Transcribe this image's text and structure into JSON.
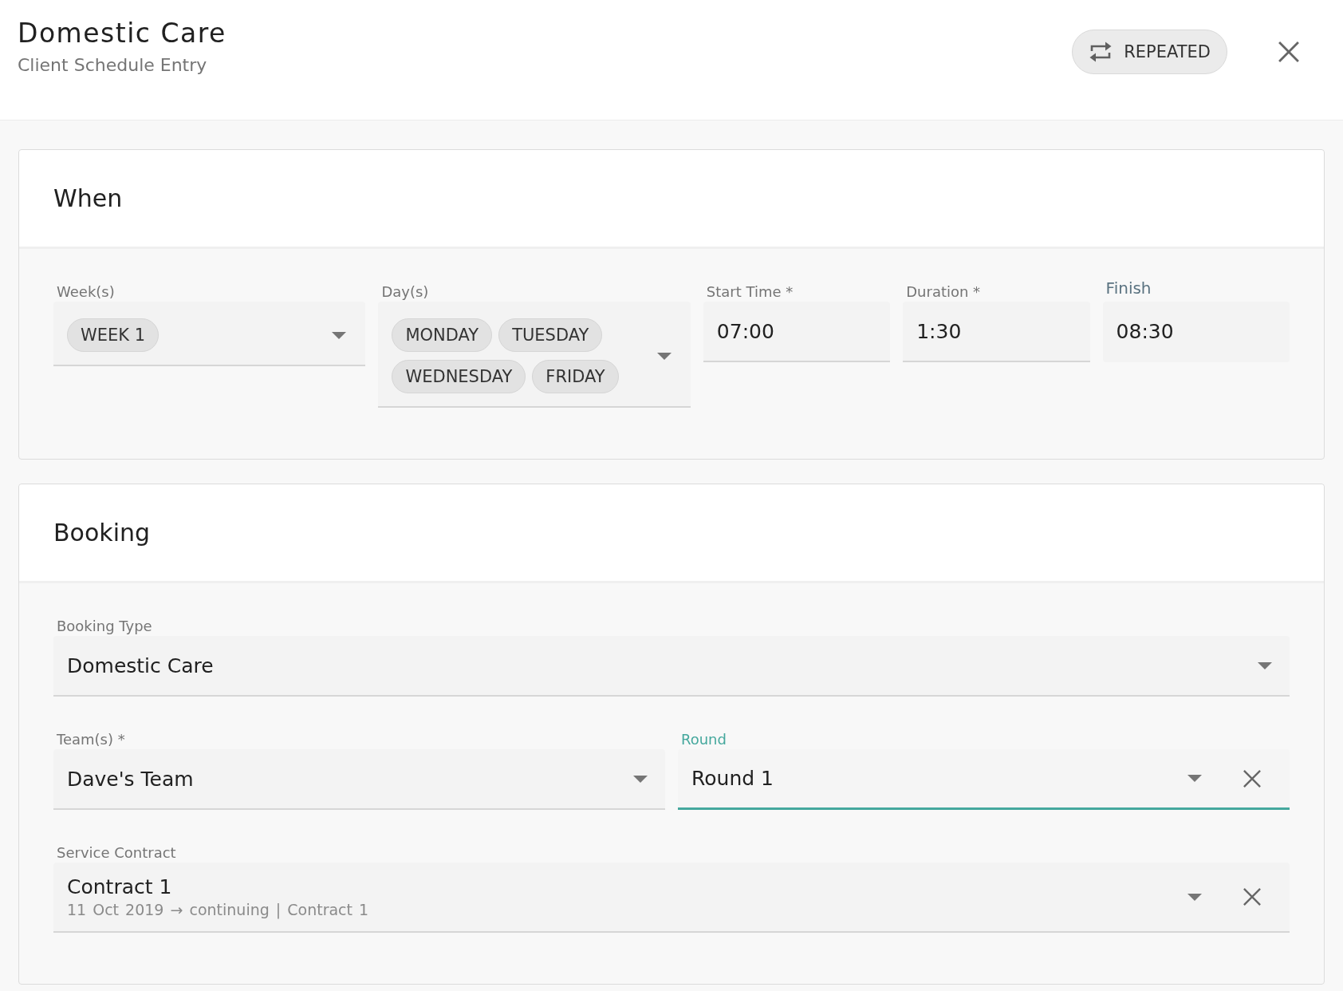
{
  "header": {
    "title": "Domestic Care",
    "subtitle": "Client Schedule Entry",
    "repeat_button": {
      "label": "REPEATED"
    }
  },
  "sections": [
    {
      "title": "When",
      "rows": [
        {
          "fields": [
            {
              "kind": "chips",
              "label": "Week(s)",
              "chips": [
                "WEEK 1"
              ],
              "focused": false,
              "readonly": false,
              "clearable": false
            },
            {
              "kind": "chips",
              "label": "Day(s)",
              "chips": [
                "MONDAY",
                "TUESDAY",
                "WEDNESDAY",
                "FRIDAY"
              ],
              "focused": false,
              "readonly": false,
              "clearable": false
            },
            {
              "kind": "text",
              "label": "Start Time *",
              "value": "07:00",
              "focused": false,
              "readonly": false,
              "clearable": false
            },
            {
              "kind": "text",
              "label": "Duration *",
              "value": "1:30",
              "focused": false,
              "readonly": false,
              "clearable": false
            },
            {
              "kind": "text",
              "label": "Finish",
              "value": "08:30",
              "focused": false,
              "readonly": true,
              "clearable": false
            }
          ]
        }
      ]
    },
    {
      "title": "Booking",
      "rows": [
        {
          "fields": [
            {
              "kind": "select",
              "label": "Booking Type",
              "value": "Domestic Care",
              "focused": false,
              "readonly": false,
              "clearable": false
            }
          ]
        },
        {
          "fields": [
            {
              "kind": "select",
              "label": "Team(s) *",
              "value": "Dave's Team",
              "focused": false,
              "readonly": false,
              "clearable": false
            },
            {
              "kind": "select",
              "label": "Round",
              "value": "Round 1",
              "focused": true,
              "readonly": false,
              "clearable": true
            }
          ]
        },
        {
          "fields": [
            {
              "kind": "select",
              "label": "Service Contract",
              "value": "Contract 1",
              "detail": "11 Oct 2019 → continuing | Contract 1",
              "focused": false,
              "readonly": false,
              "clearable": true
            }
          ]
        }
      ]
    }
  ]
}
